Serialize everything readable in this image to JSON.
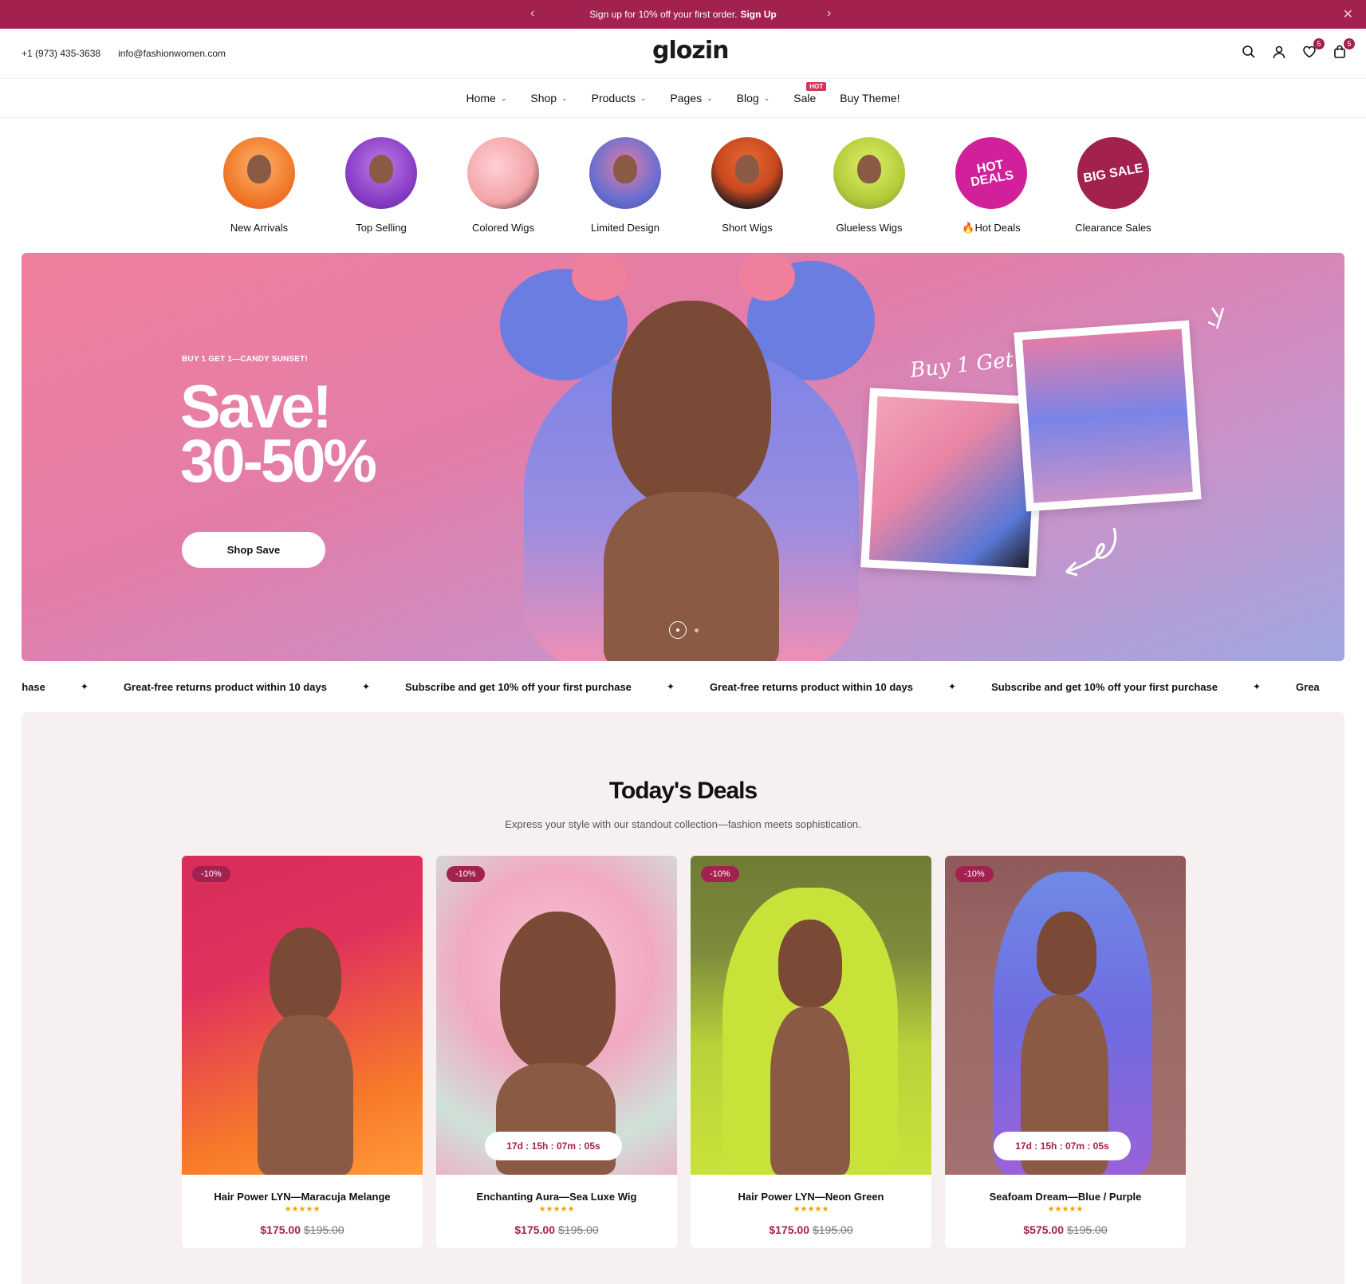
{
  "announcement": {
    "text": "Sign up for 10% off your first order.",
    "link": "Sign Up"
  },
  "header": {
    "phone": "+1 (973) 435-3638",
    "email": "info@fashionwomen.com",
    "logo": "glozin",
    "wishlist_count": "5",
    "cart_count": "5"
  },
  "nav": {
    "items": [
      {
        "label": "Home",
        "dropdown": true
      },
      {
        "label": "Shop",
        "dropdown": true
      },
      {
        "label": "Products",
        "dropdown": true
      },
      {
        "label": "Pages",
        "dropdown": true
      },
      {
        "label": "Blog",
        "dropdown": true
      },
      {
        "label": "Sale",
        "dropdown": false
      },
      {
        "label": "Buy Theme!",
        "dropdown": false
      }
    ],
    "hot_badge": "HOT"
  },
  "categories": [
    {
      "label": "New Arrivals",
      "color": "#f07a2a"
    },
    {
      "label": "Top Selling",
      "color": "#8a3fc7"
    },
    {
      "label": "Colored Wigs",
      "color": "#f3a3a8"
    },
    {
      "label": "Limited Design",
      "color": "#6a6fd0"
    },
    {
      "label": "Short Wigs",
      "color": "#c9481f"
    },
    {
      "label": "Glueless Wigs",
      "color": "#b5cc3a"
    },
    {
      "label": "🔥Hot Deals",
      "color": "#d0209a",
      "badge_text": "HOT DEALS"
    },
    {
      "label": "Clearance Sales",
      "color": "#a3214f",
      "badge_text": "BIG SALE"
    }
  ],
  "hero": {
    "kicker": "BUY 1 GET 1—CANDY SUNSET!",
    "headline_1": "Save!",
    "headline_2": "30-50%",
    "button": "Shop Save",
    "script_text": "Buy 1 Get 2"
  },
  "marquee": {
    "items": [
      "urchase",
      "Great-free returns product within 10 days",
      "Subscribe and get 10% off your first purchase",
      "Great-free returns product within 10 days",
      "Subscribe and get 10% off your first purchase",
      "Grea"
    ]
  },
  "deals": {
    "title": "Today's Deals",
    "description": "Express your style with our standout collection—fashion meets sophistication.",
    "products": [
      {
        "name": "Hair Power LYN—Maracuja Melange",
        "discount": "-10%",
        "price": "$175.00",
        "old_price": "$195.00",
        "rating": 4.5,
        "stars": "★★★★★",
        "timer": "",
        "colors": [
          "#e0325d",
          "#f7782a"
        ]
      },
      {
        "name": "Enchanting Aura—Sea Luxe Wig",
        "discount": "-10%",
        "price": "$175.00",
        "old_price": "$195.00",
        "rating": 4.5,
        "stars": "★★★★★",
        "timer": "17d : 15h : 07m : 05s",
        "colors": [
          "#f1a9c1",
          "#cfe2d8"
        ]
      },
      {
        "name": "Hair Power LYN—Neon Green",
        "discount": "-10%",
        "price": "$175.00",
        "old_price": "$195.00",
        "rating": 4.5,
        "stars": "★★★★★",
        "timer": "",
        "colors": [
          "#7d8b3b",
          "#c9e23a"
        ]
      },
      {
        "name": "Seafoam Dream—Blue / Purple",
        "discount": "-10%",
        "price": "$575.00",
        "old_price": "$195.00",
        "rating": 4.5,
        "stars": "★★★★★",
        "timer": "17d : 15h : 07m : 05s",
        "colors": [
          "#8e5a5a",
          "#6f6be0"
        ]
      }
    ]
  }
}
